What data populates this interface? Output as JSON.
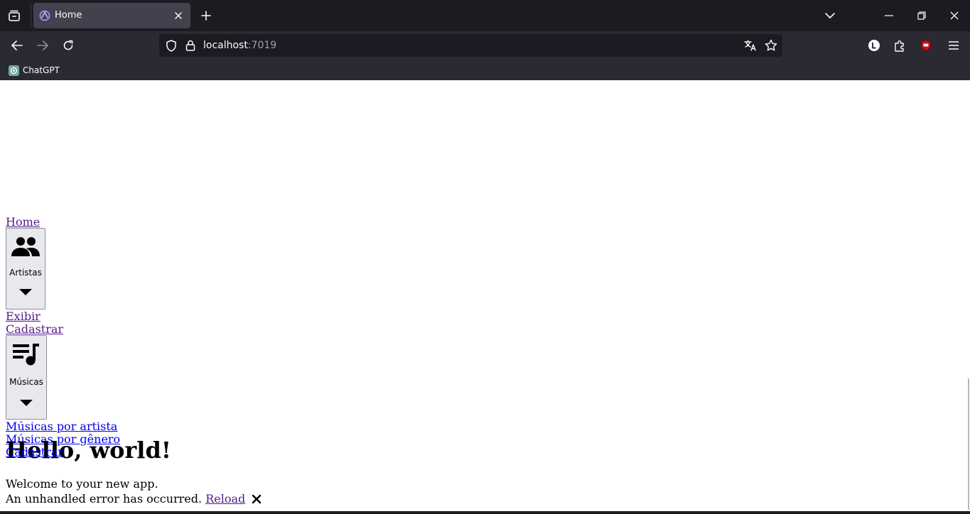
{
  "browser": {
    "tab": {
      "title": "Home"
    },
    "url": {
      "host": "localhost",
      "port": ":7019"
    },
    "bookmarks": [
      {
        "label": "ChatGPT"
      }
    ],
    "accent": "#1c1b22"
  },
  "nav": {
    "home_link": "Home",
    "artists": {
      "label": "Artistas",
      "icon": "people-icon",
      "links": [
        "Exibir",
        "Cadastrar"
      ]
    },
    "songs": {
      "label": "Músicas",
      "icon": "queue-music-icon",
      "links": [
        "Músicas por artista",
        "Músicas por gênero",
        "Cadastrar"
      ]
    }
  },
  "main": {
    "title": "Hello, world!",
    "welcome": "Welcome to your new app."
  },
  "error_ui": {
    "message": "An unhandled error has occurred.",
    "reload": "Reload",
    "dismiss_icon": "close-icon"
  }
}
